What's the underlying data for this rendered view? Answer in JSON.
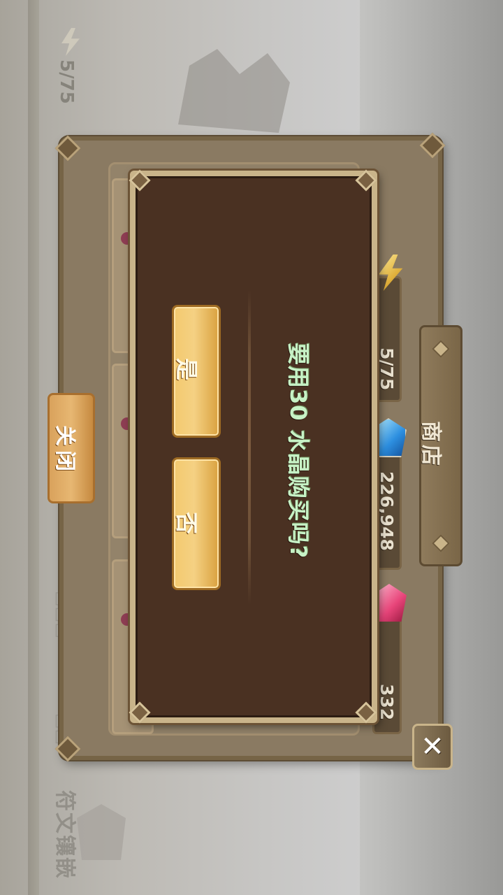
{
  "hud": {
    "energy": "5/75",
    "rune_inlay": "符文镶嵌"
  },
  "shop": {
    "tab_label": "商店",
    "close_label": "关闭",
    "close_x": "✕",
    "resources": {
      "energy": "5/75",
      "crystal": "226,948",
      "gem": "332"
    }
  },
  "confirm": {
    "question": "要用30 水晶购买吗?",
    "yes_label": "是",
    "no_label": "否"
  },
  "icons": [
    "energy-icon",
    "crystal-icon",
    "gem-icon",
    "close-icon",
    "rune-icon"
  ]
}
